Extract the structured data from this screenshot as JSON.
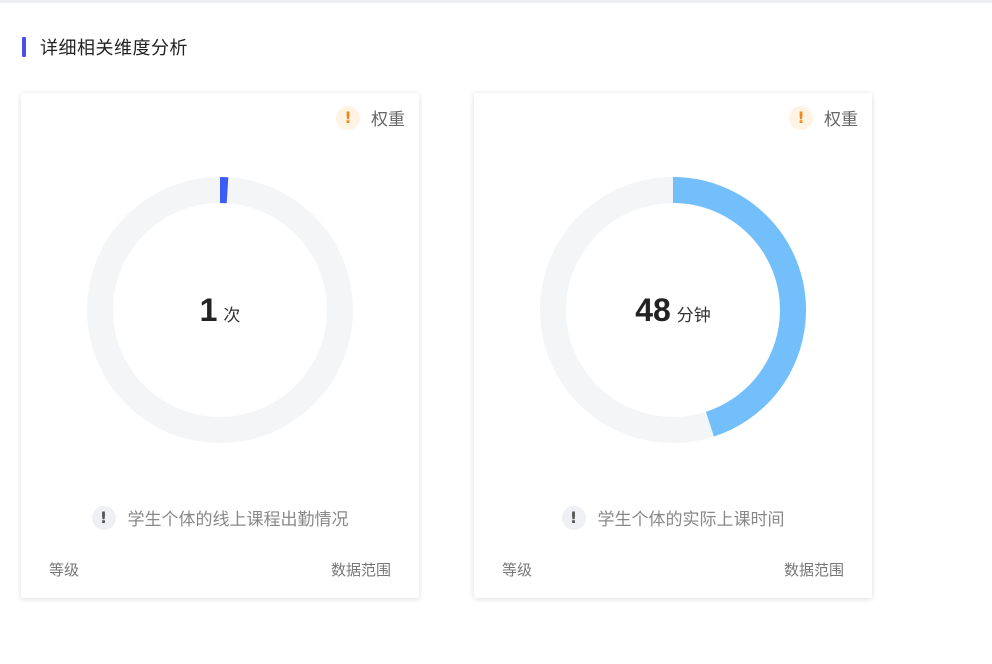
{
  "section": {
    "title": "详细相关维度分析",
    "accent_color": "#4a4ef0"
  },
  "cards": [
    {
      "weight_icon": "exclamation-icon",
      "weight_label": "权重",
      "value": "1",
      "unit": "次",
      "ring_fraction": 0.01,
      "ring_color": "#3d5cf5",
      "track_color": "#f4f5f7",
      "description": "学生个体的线上课程出勤情况",
      "level_label": "等级",
      "range_label": "数据范围"
    },
    {
      "weight_icon": "exclamation-icon",
      "weight_label": "权重",
      "value": "48",
      "unit": "分钟",
      "ring_fraction": 0.45,
      "ring_color": "#72bffb",
      "track_color": "#f4f5f7",
      "description": "学生个体的实际上课时间",
      "level_label": "等级",
      "range_label": "数据范围"
    }
  ]
}
